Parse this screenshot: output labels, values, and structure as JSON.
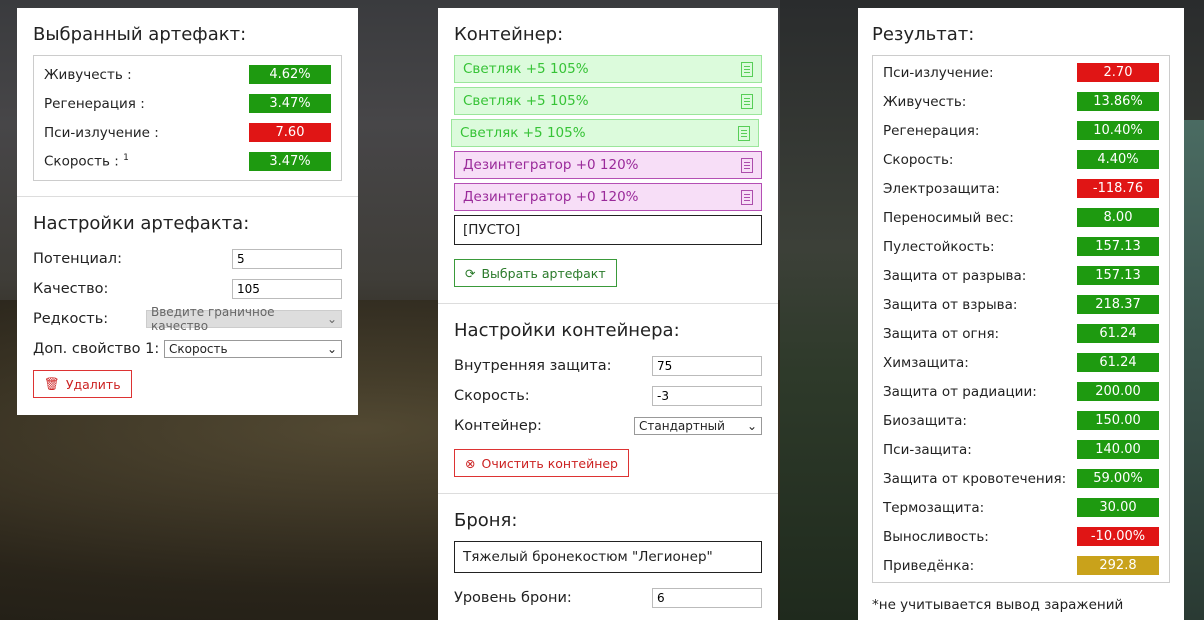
{
  "left": {
    "title": "Выбранный артефакт:",
    "stats": [
      {
        "label": "Живучесть :",
        "value": "4.62%",
        "color": "green"
      },
      {
        "label": "Регенерация :",
        "value": "3.47%",
        "color": "green"
      },
      {
        "label": "Пси-излучение :",
        "value": "7.60",
        "color": "red"
      },
      {
        "label": "Скорость :",
        "sup": "1",
        "value": "3.47%",
        "color": "green"
      }
    ],
    "settings_title": "Настройки артефакта:",
    "potential_label": "Потенциал:",
    "potential_value": "5",
    "quality_label": "Качество:",
    "quality_value": "105",
    "rarity_label": "Редкость:",
    "rarity_placeholder": "Введите граничное качество",
    "extra_label": "Доп. свойство 1:",
    "extra_value": "Скорость",
    "delete_button": "Удалить"
  },
  "middle": {
    "title": "Контейнер:",
    "slots": [
      {
        "text": "Светляк +5 105%",
        "type": "green"
      },
      {
        "text": "Светляк +5 105%",
        "type": "green"
      },
      {
        "text": "Светляк +5 105%",
        "type": "green"
      },
      {
        "text": "Дезинтегратор +0 120%",
        "type": "purple"
      },
      {
        "text": "Дезинтегратор +0 120%",
        "type": "purple"
      },
      {
        "text": "[ПУСТО]",
        "type": "empty"
      }
    ],
    "choose_button": "Выбрать артефакт",
    "settings_title": "Настройки контейнера:",
    "inner_protection_label": "Внутренняя защита:",
    "inner_protection_value": "75",
    "speed_label": "Скорость:",
    "speed_value": "-3",
    "container_label": "Контейнер:",
    "container_value": "Стандартный",
    "clear_button": "Очистить контейнер",
    "armor_title": "Броня:",
    "armor_value": "Тяжелый бронекостюм \"Легионер\"",
    "armor_level_label": "Уровень брони:",
    "armor_level_value": "6"
  },
  "right": {
    "title": "Результат:",
    "stats": [
      {
        "label": "Пси-излучение:",
        "value": "2.70",
        "color": "red"
      },
      {
        "label": "Живучесть:",
        "value": "13.86%",
        "color": "green"
      },
      {
        "label": "Регенерация:",
        "value": "10.40%",
        "color": "green"
      },
      {
        "label": "Скорость:",
        "value": "4.40%",
        "color": "green"
      },
      {
        "label": "Электрозащита:",
        "value": "-118.76",
        "color": "red"
      },
      {
        "label": "Переносимый вес:",
        "value": "8.00",
        "color": "green"
      },
      {
        "label": "Пулестойкость:",
        "value": "157.13",
        "color": "green"
      },
      {
        "label": "Защита от разрыва:",
        "value": "157.13",
        "color": "green"
      },
      {
        "label": "Защита от взрыва:",
        "value": "218.37",
        "color": "green"
      },
      {
        "label": "Защита от огня:",
        "value": "61.24",
        "color": "green"
      },
      {
        "label": "Химзащита:",
        "value": "61.24",
        "color": "green"
      },
      {
        "label": "Защита от радиации:",
        "value": "200.00",
        "color": "green"
      },
      {
        "label": "Биозащита:",
        "value": "150.00",
        "color": "green"
      },
      {
        "label": "Пси-защита:",
        "value": "140.00",
        "color": "green"
      },
      {
        "label": "Защита от кровотечения:",
        "value": "59.00%",
        "color": "green"
      },
      {
        "label": "Термозащита:",
        "value": "30.00",
        "color": "green"
      },
      {
        "label": "Выносливость:",
        "value": "-10.00%",
        "color": "red"
      },
      {
        "label": "Приведёнка:",
        "value": "292.8",
        "color": "yellow"
      }
    ],
    "note": "*не учитывается вывод заражений"
  }
}
